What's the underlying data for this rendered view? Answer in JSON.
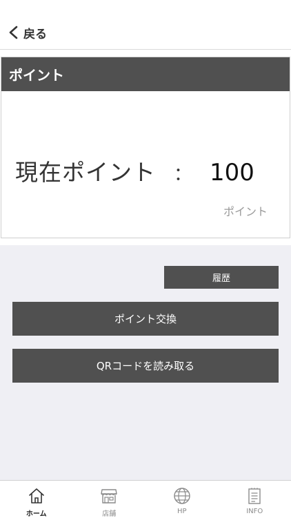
{
  "nav": {
    "back_label": "戻る"
  },
  "card": {
    "header_title": "ポイント",
    "points_label": "現在ポイント",
    "colon": "：",
    "points_value": "100",
    "unit_label": "ポイント"
  },
  "actions": {
    "history_label": "履歴",
    "exchange_label": "ポイント交換",
    "qr_label": "QRコードを読み取る"
  },
  "tabbar": {
    "items": [
      {
        "label": "ホーム",
        "icon": "home-icon",
        "active": true
      },
      {
        "label": "店舗",
        "icon": "store-icon",
        "active": false
      },
      {
        "label": "HP",
        "icon": "globe-icon",
        "active": false
      },
      {
        "label": "INFO",
        "icon": "clipboard-icon",
        "active": false
      }
    ]
  },
  "colors": {
    "header_bg": "#505050",
    "button_bg": "#505050",
    "area_bg": "#efeff4",
    "muted_text": "#9a9a9a"
  }
}
